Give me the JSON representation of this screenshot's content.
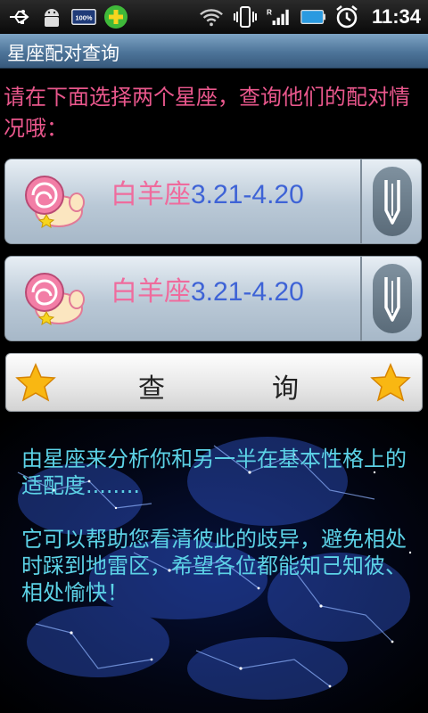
{
  "status_bar": {
    "time": "11:34",
    "battery_badge": "100%",
    "icons": [
      "usb-icon",
      "android-debug-icon",
      "battery-badge-icon",
      "plus-app-icon",
      "wifi-icon",
      "vibrate-icon",
      "signal-icon",
      "battery-icon",
      "alarm-icon"
    ]
  },
  "title_bar": {
    "title": "星座配对查询"
  },
  "instruction": "请在下面选择两个星座，查询他们的配对情况哦：",
  "spinners": [
    {
      "name": "白羊座",
      "dates": "3.21-4.20"
    },
    {
      "name": "白羊座",
      "dates": "3.21-4.20"
    }
  ],
  "query_button": {
    "char1": "查",
    "char2": "询"
  },
  "description": {
    "para1": "由星座来分析你和另一半在基本性格上的适配度........",
    "para2": "它可以帮助您看清彼此的歧异，避免相处时踩到地雷区，希望各位都能知己知彼、相处愉快！"
  },
  "colors": {
    "instruction_pink": "#e9578c",
    "sign_name_pink": "#ef6b9d",
    "sign_dates_blue": "#3e63d6",
    "description_cyan": "#5cd2e6",
    "title_bar_blue": "#4d7499"
  }
}
